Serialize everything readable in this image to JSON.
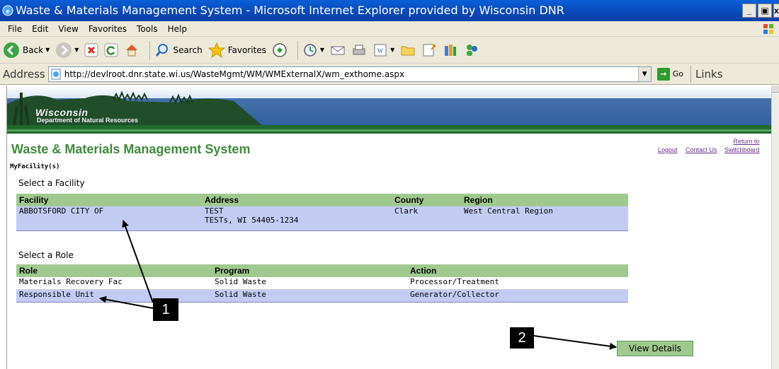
{
  "window": {
    "title": "Waste & Materials Management System - Microsoft Internet Explorer provided by Wisconsin DNR",
    "controls": [
      "_",
      "̷",
      "x"
    ]
  },
  "menu": [
    "File",
    "Edit",
    "View",
    "Favorites",
    "Tools",
    "Help"
  ],
  "toolbar": {
    "back": "Back",
    "search": "Search",
    "favorites": "Favorites"
  },
  "address": {
    "label": "Address",
    "url": "http://devlroot.dnr.state.wi.us/WasteMgmt/WM/WMExternalX/wm_exthome.aspx",
    "go": "Go",
    "links": "Links"
  },
  "banner": {
    "agency_line1": "Wisconsin",
    "agency_line2": "Department of Natural Resources",
    "colors": {
      "sky": "#2c5fa0",
      "stripe": "#1e6b2c"
    }
  },
  "header": {
    "title": "Waste & Materials Management System",
    "logout": "Logout",
    "contact": "Contact Us",
    "return_line1": "Return to",
    "return_line2": "Switchboard",
    "section": "MyFacility(s)"
  },
  "facility": {
    "label": "Select a Facility",
    "columns": [
      "Facility",
      "Address",
      "County",
      "Region"
    ],
    "rows": [
      {
        "facility": "ABBOTSFORD CITY OF",
        "address_line1": "TEST",
        "address_line2": "TESTs, WI 54405-1234",
        "county": "Clark",
        "region": "West Central Region"
      }
    ]
  },
  "role": {
    "label": "Select a Role",
    "columns": [
      "Role",
      "Program",
      "Action"
    ],
    "rows": [
      {
        "role": "Materials Recovery Fac",
        "program": "Solid Waste",
        "action": "Processor/Treatment"
      },
      {
        "role": "Responsible Unit",
        "program": "Solid Waste",
        "action": "Generator/Collector"
      }
    ]
  },
  "view_details": "View Details",
  "callouts": {
    "one": "1",
    "two": "2"
  },
  "accent_colors": {
    "header_green": "#3e8a3e",
    "grid_header": "#9fc98f",
    "selected_row": "#c2ccf3"
  }
}
